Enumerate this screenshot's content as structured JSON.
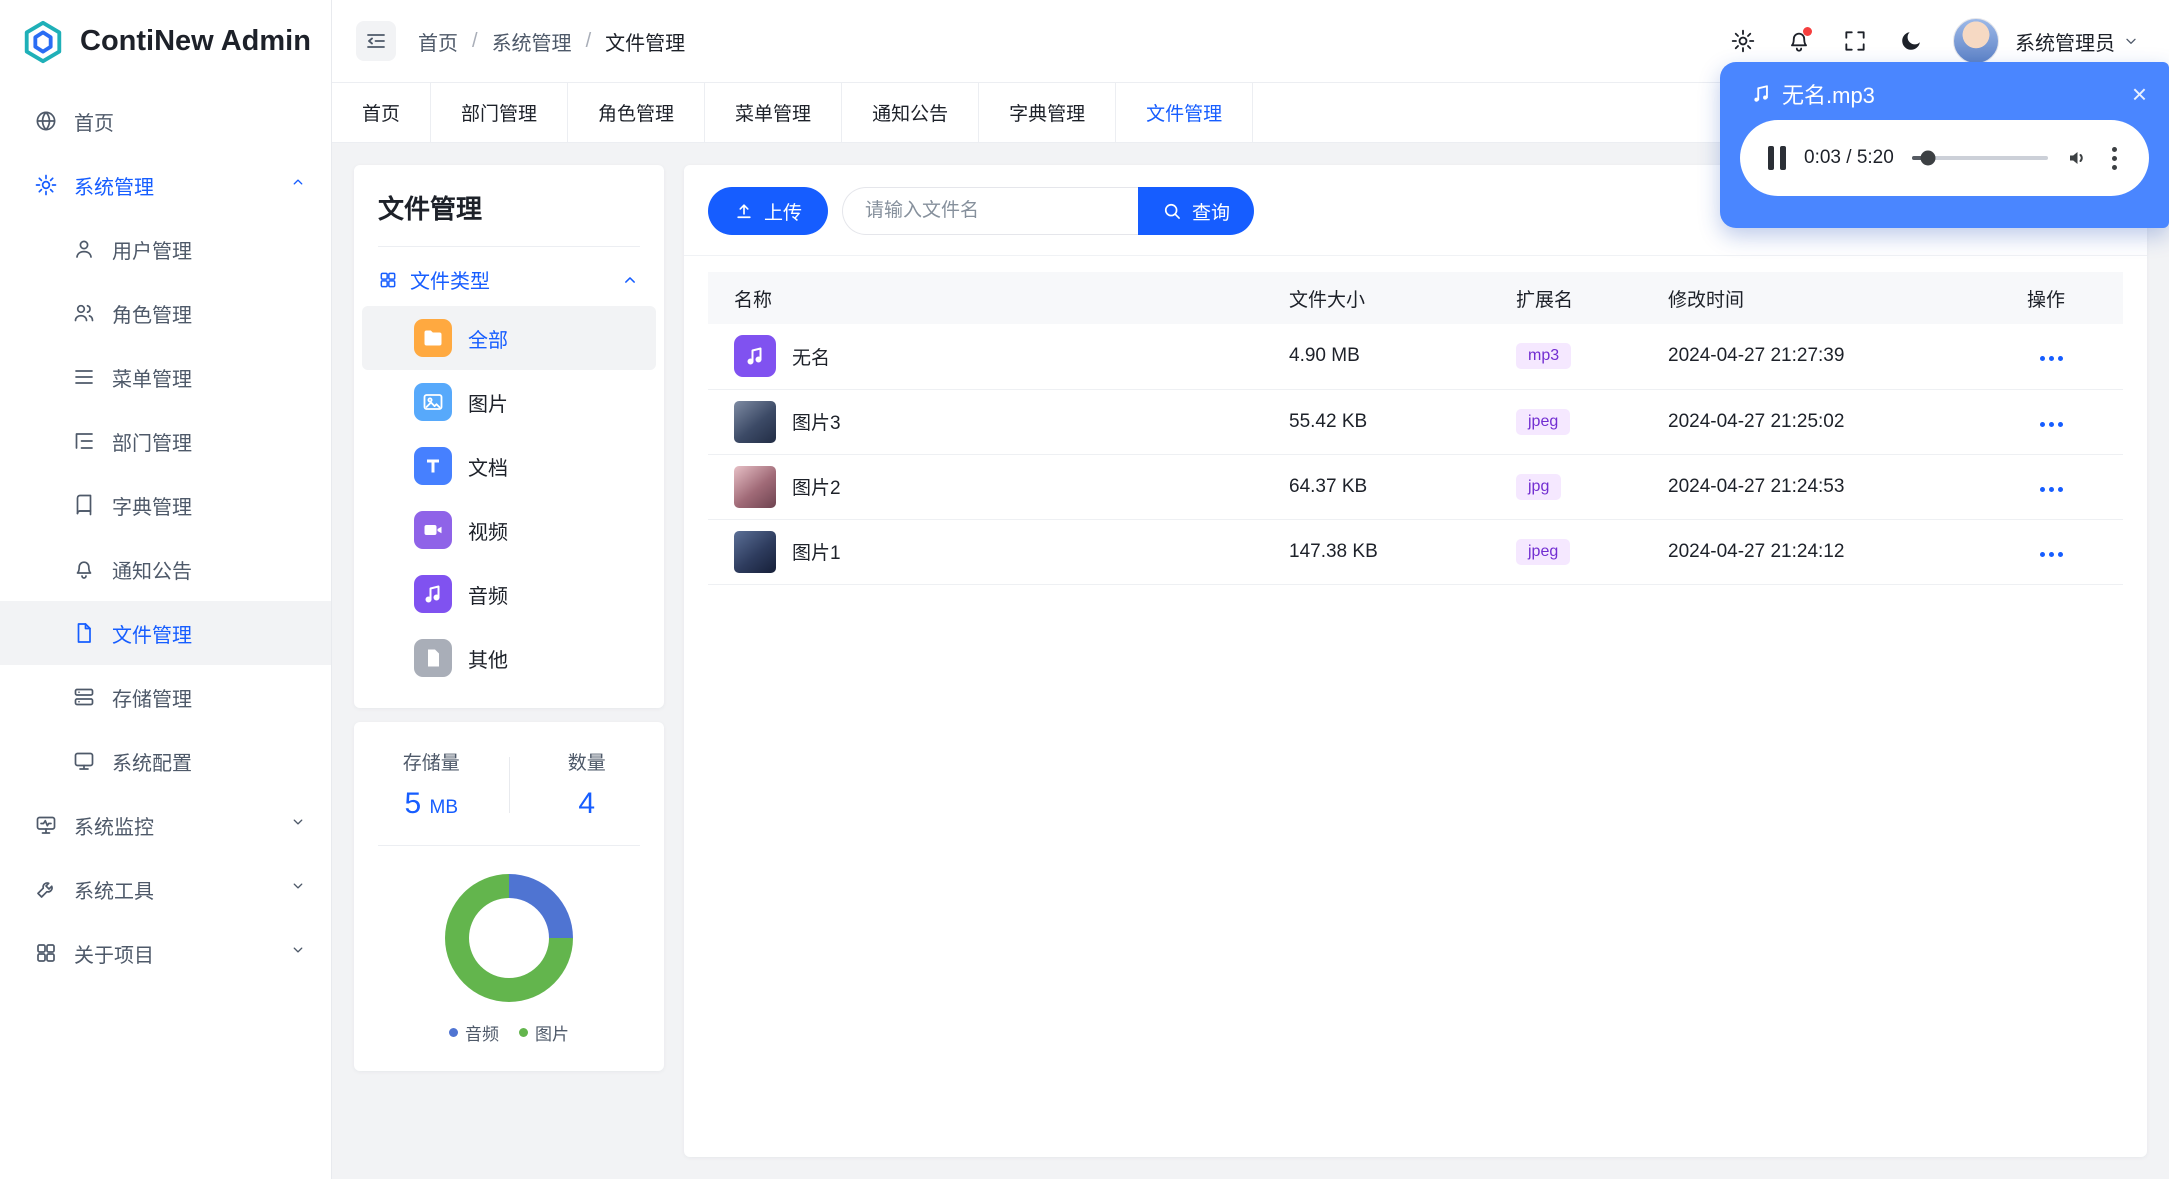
{
  "app": {
    "title": "ContiNew Admin"
  },
  "header": {
    "breadcrumb": [
      "首页",
      "系统管理",
      "文件管理"
    ],
    "user": {
      "name": "系统管理员"
    }
  },
  "sidebar": {
    "home": "首页",
    "system": "系统管理",
    "children": [
      "用户管理",
      "角色管理",
      "菜单管理",
      "部门管理",
      "字典管理",
      "通知公告",
      "文件管理",
      "存储管理",
      "系统配置"
    ],
    "monitor": "系统监控",
    "tools": "系统工具",
    "about": "关于项目"
  },
  "tabs": [
    "首页",
    "部门管理",
    "角色管理",
    "菜单管理",
    "通知公告",
    "字典管理",
    "文件管理"
  ],
  "panel": {
    "title": "文件管理",
    "section": "文件类型",
    "types": [
      "全部",
      "图片",
      "文档",
      "视频",
      "音频",
      "其他"
    ],
    "stats": {
      "storage_label": "存储量",
      "storage_value": "5",
      "storage_unit": "MB",
      "count_label": "数量",
      "count_value": "4"
    }
  },
  "chart_data": {
    "type": "pie",
    "categories": [
      "音频",
      "图片"
    ],
    "values": [
      1,
      3
    ],
    "colors": [
      "#4f74d2",
      "#63b54d"
    ],
    "legend_position": "bottom",
    "title": ""
  },
  "toolbar": {
    "upload": "上传",
    "search_placeholder": "请输入文件名",
    "query": "查询"
  },
  "files": {
    "columns": [
      "名称",
      "文件大小",
      "扩展名",
      "修改时间",
      "操作"
    ],
    "rows": [
      {
        "name": "无名",
        "size": "4.90 MB",
        "ext": "mp3",
        "time": "2024-04-27 21:27:39"
      },
      {
        "name": "图片3",
        "size": "55.42 KB",
        "ext": "jpeg",
        "time": "2024-04-27 21:25:02"
      },
      {
        "name": "图片2",
        "size": "64.37 KB",
        "ext": "jpg",
        "time": "2024-04-27 21:24:53"
      },
      {
        "name": "图片1",
        "size": "147.38 KB",
        "ext": "jpeg",
        "time": "2024-04-27 21:24:12"
      }
    ]
  },
  "player": {
    "title": "无名.mp3",
    "time": "0:03 / 5:20",
    "close": "×"
  },
  "colors": {
    "primary": "#165DFF",
    "player_bg": "#4a86ff",
    "badge_bg": "#F5E8FF",
    "badge_text": "#722ED1"
  }
}
